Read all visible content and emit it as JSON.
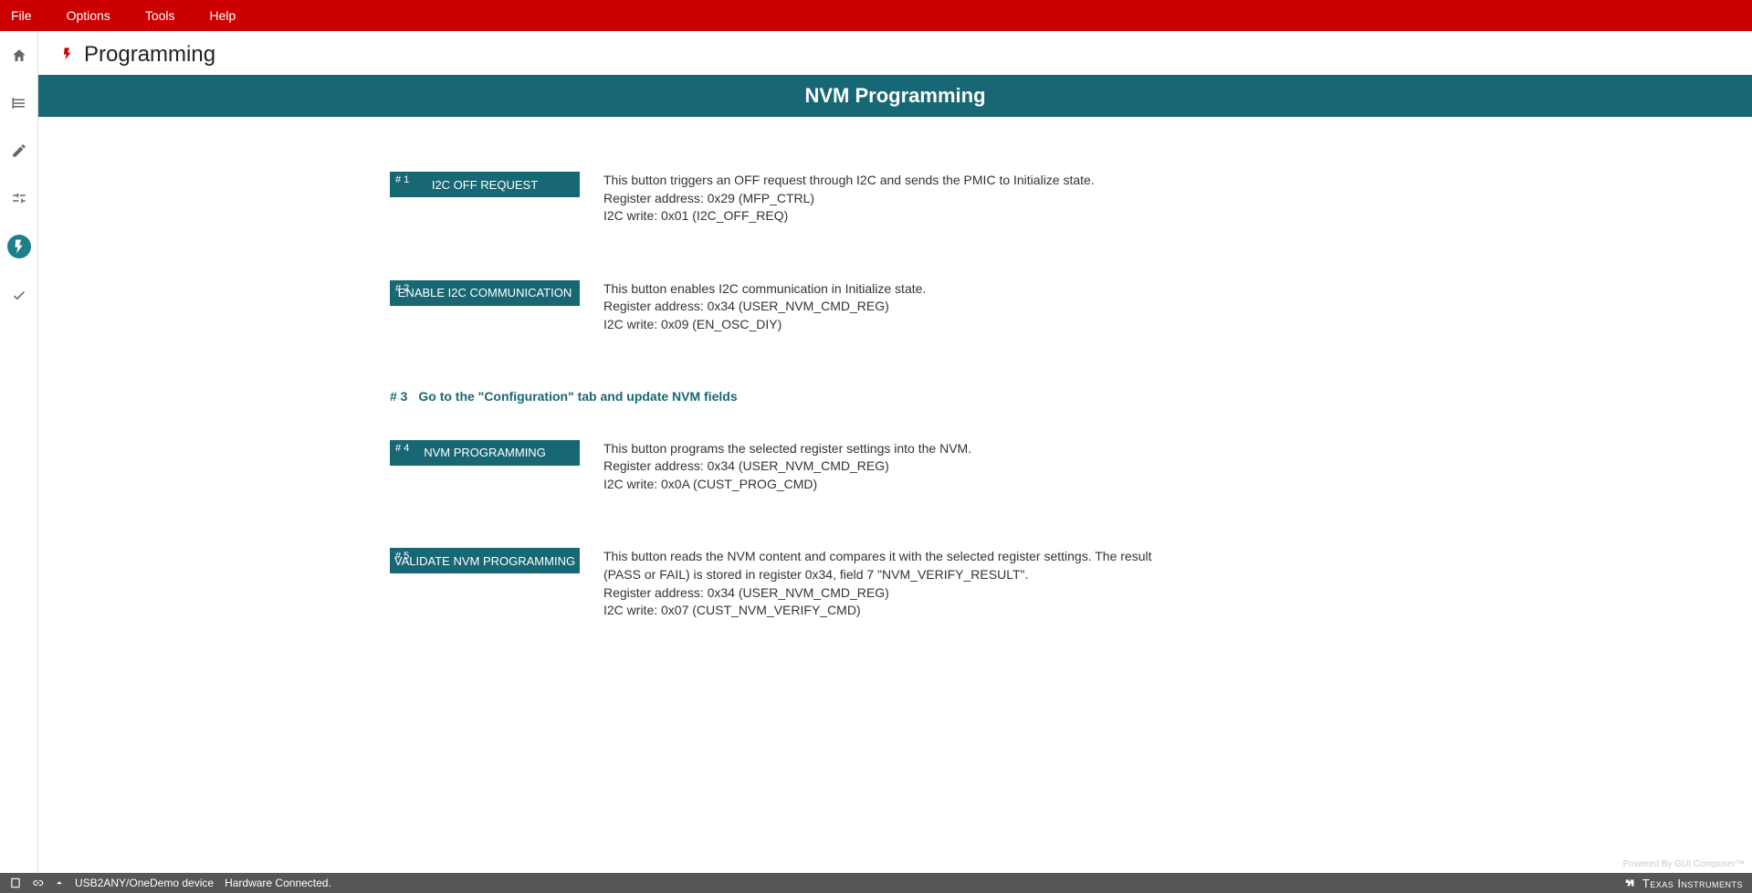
{
  "menubar": {
    "items": [
      "File",
      "Options",
      "Tools",
      "Help"
    ]
  },
  "sidebar": {
    "items": [
      {
        "name": "home-icon"
      },
      {
        "name": "library-icon"
      },
      {
        "name": "pencil-icon"
      },
      {
        "name": "sliders-icon"
      },
      {
        "name": "bolt-icon",
        "active": true
      },
      {
        "name": "check-icon"
      }
    ]
  },
  "page": {
    "title": "Programming",
    "banner": "NVM Programming"
  },
  "steps": [
    {
      "num": "# 1",
      "button": "I2C OFF REQUEST",
      "desc": [
        "This button triggers an OFF request through I2C and sends the PMIC to Initialize state.",
        "Register address: 0x29 (MFP_CTRL)",
        "I2C write: 0x01 (I2C_OFF_REQ)"
      ]
    },
    {
      "num": "# 2",
      "button": "ENABLE I2C COMMUNICATION",
      "desc": [
        "This button enables I2C communication in Initialize state.",
        "Register address: 0x34 (USER_NVM_CMD_REG)",
        "I2C write: 0x09 (EN_OSC_DIY)"
      ]
    },
    {
      "num": "# 3",
      "instruction": "Go to the \"Configuration\" tab and update NVM fields"
    },
    {
      "num": "# 4",
      "button": "NVM PROGRAMMING",
      "desc": [
        "This button programs the selected register settings into the NVM.",
        "Register address: 0x34 (USER_NVM_CMD_REG)",
        "I2C write: 0x0A (CUST_PROG_CMD)"
      ]
    },
    {
      "num": "# 5",
      "button": "VALIDATE NVM PROGRAMMING",
      "desc": [
        "This button reads the NVM content and compares it with the selected register settings. The result (PASS or FAIL) is stored in register 0x34, field 7 \"NVM_VERIFY_RESULT\".",
        "Register address: 0x34 (USER_NVM_CMD_REG)",
        "I2C write: 0x07 (CUST_NVM_VERIFY_CMD)"
      ]
    }
  ],
  "powered": "Powered By GUI Composer™",
  "statusbar": {
    "device": "USB2ANY/OneDemo device",
    "status": "Hardware Connected.",
    "brand": "Texas Instruments"
  }
}
